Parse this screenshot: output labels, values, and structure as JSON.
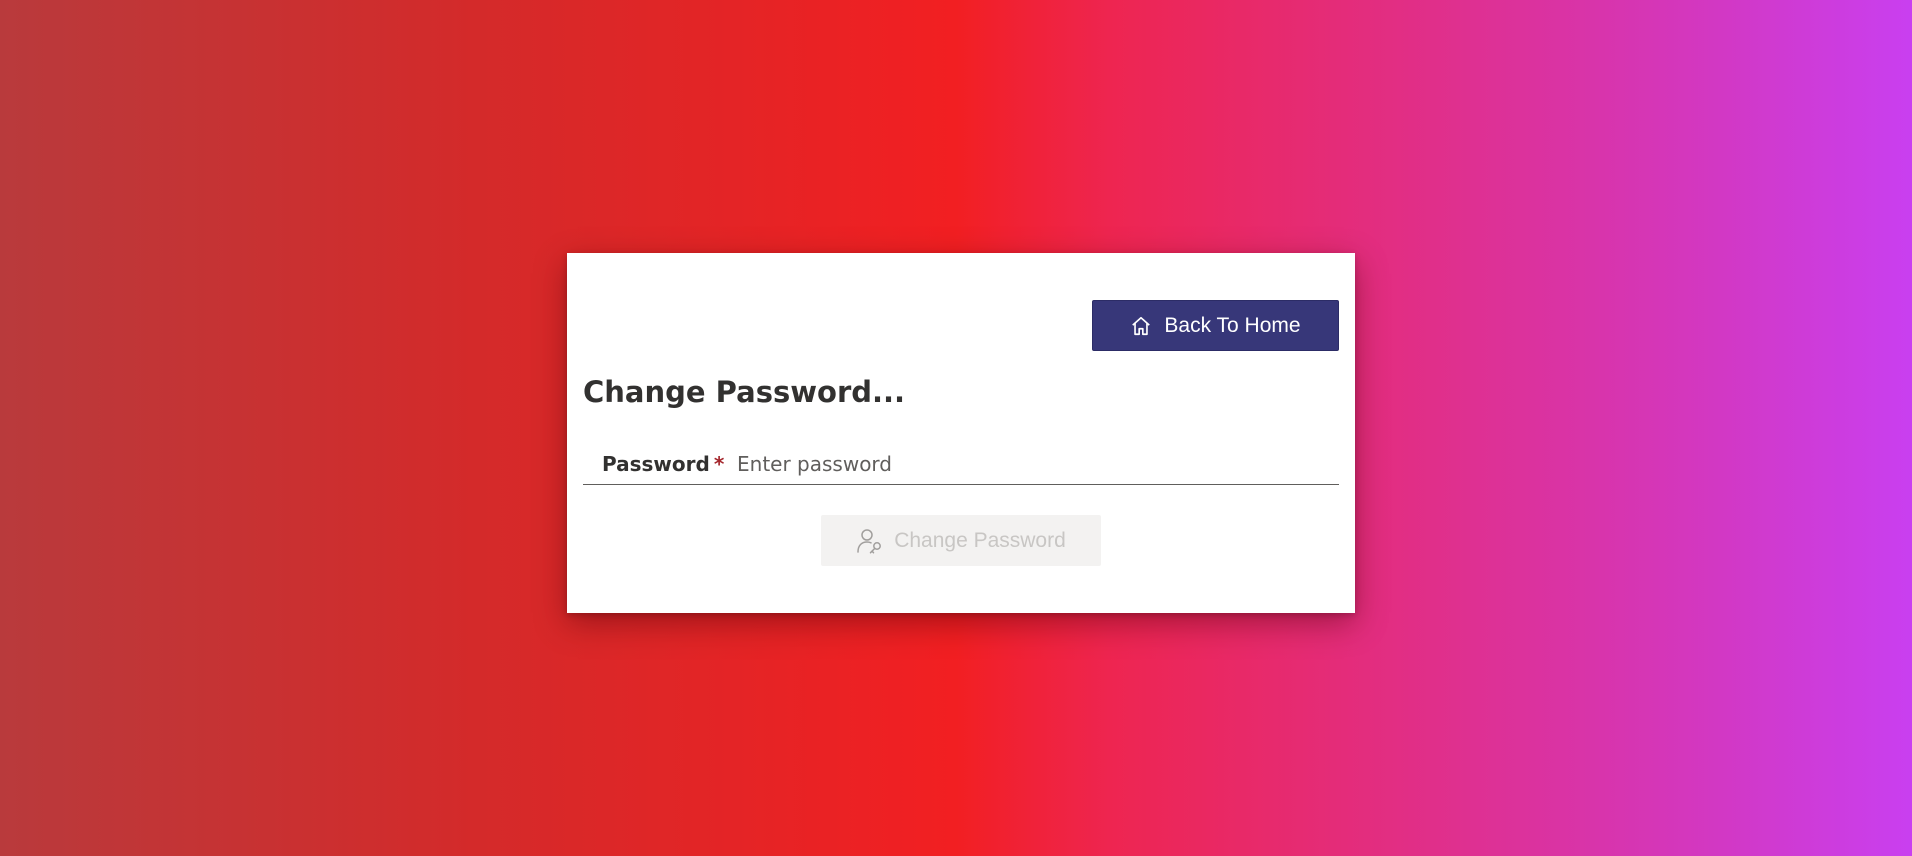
{
  "header": {
    "back_home": {
      "label": "Back To Home",
      "icon": "home-icon"
    }
  },
  "form": {
    "title": "Change Password...",
    "password_field": {
      "label": "Password",
      "required_marker": "*",
      "placeholder": "Enter password",
      "value": ""
    },
    "submit": {
      "label": "Change Password",
      "icon": "user-key-icon",
      "disabled": true
    }
  },
  "colors": {
    "primary_button": "#373779",
    "disabled_button_bg": "#f3f2f1",
    "disabled_text": "#c8c6c4",
    "required_marker": "#a4262c",
    "background_gradient": [
      "#b93a3c",
      "#f21f22",
      "#c93ff0"
    ]
  }
}
